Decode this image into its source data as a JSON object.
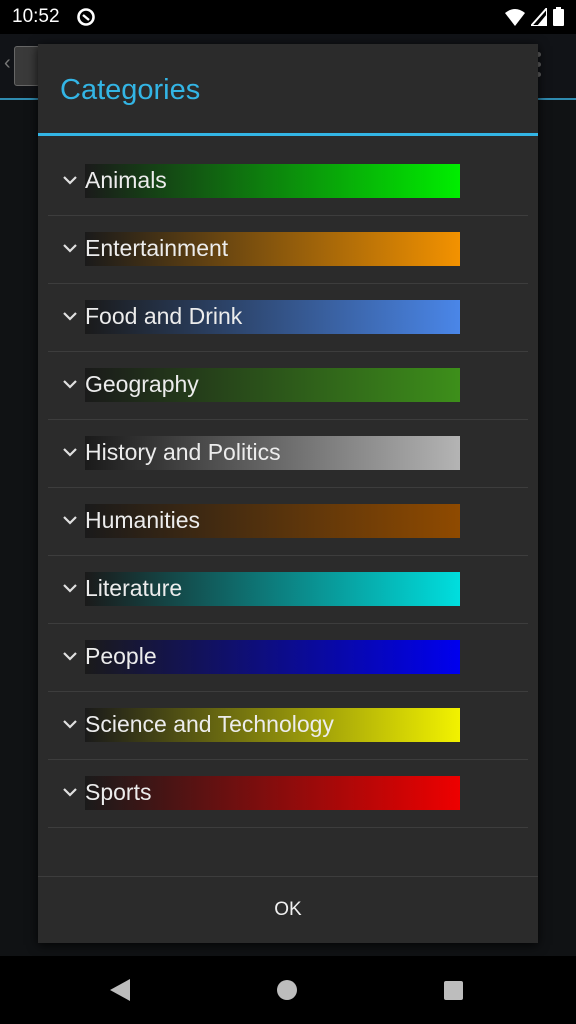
{
  "status": {
    "time": "10:52"
  },
  "dialog": {
    "title": "Categories",
    "ok_label": "OK",
    "categories": [
      {
        "label": "Animals",
        "color": "#00ee00"
      },
      {
        "label": "Entertainment",
        "color": "#f39200"
      },
      {
        "label": "Food and Drink",
        "color": "#4a86e8"
      },
      {
        "label": "Geography",
        "color": "#3d8f1a"
      },
      {
        "label": "History and Politics",
        "color": "#b4b4b4"
      },
      {
        "label": "Humanities",
        "color": "#8f4a00"
      },
      {
        "label": "Literature",
        "color": "#00dede"
      },
      {
        "label": "People",
        "color": "#0000ee"
      },
      {
        "label": "Science and Technology",
        "color": "#f2f200"
      },
      {
        "label": "Sports",
        "color": "#ee0000"
      }
    ]
  }
}
